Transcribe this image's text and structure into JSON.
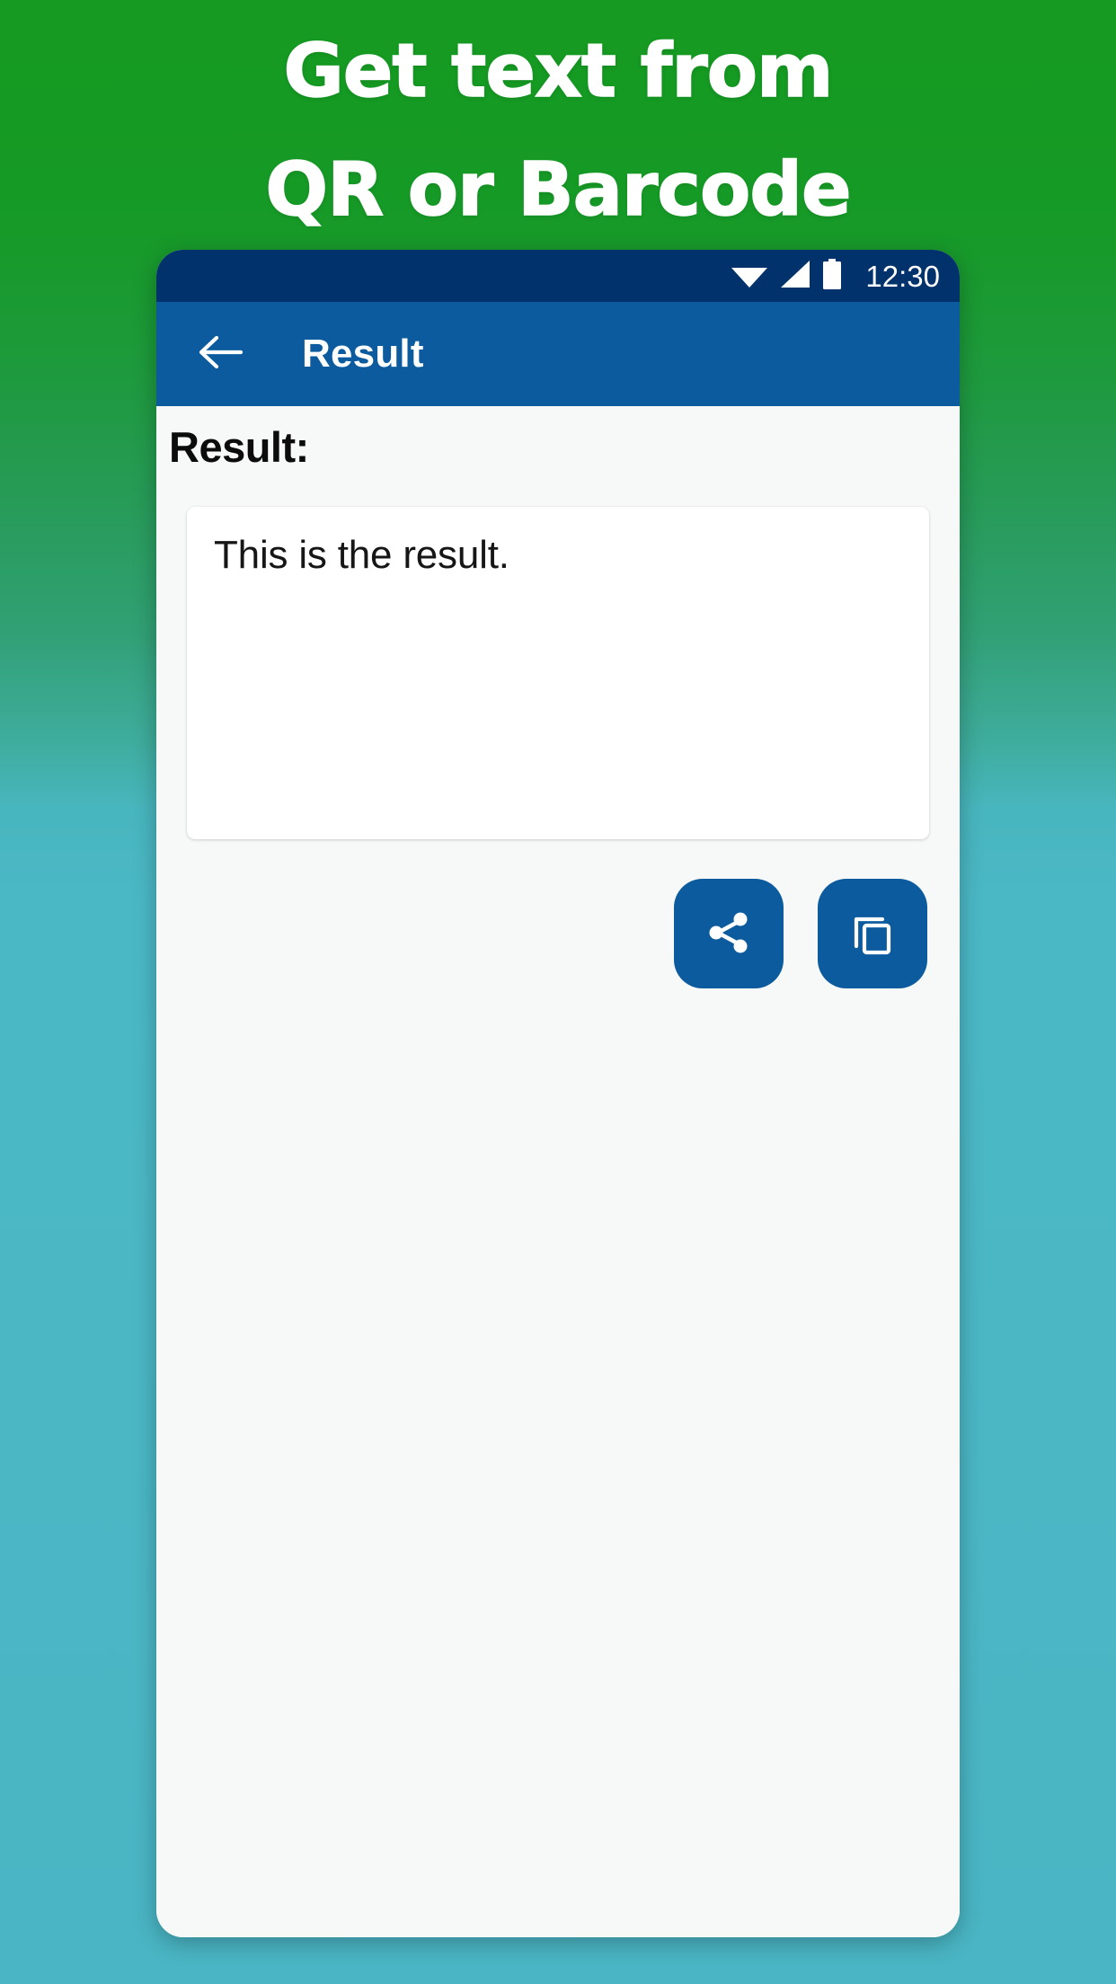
{
  "promo": {
    "headline_line1": "Get text from",
    "headline_line2": "QR or Barcode",
    "bg_gradient_top": "#169A21",
    "bg_gradient_bottom": "#4BB7C5",
    "headline_color": "#FFFFFF"
  },
  "phone": {
    "status_bar": {
      "time": "12:30",
      "background": "#01326B",
      "icons": [
        "wifi-icon",
        "cellular-signal-icon",
        "battery-icon"
      ]
    },
    "app_bar": {
      "title": "Result",
      "background": "#0B5B9E",
      "back_icon": "arrow-left-icon"
    },
    "content": {
      "section_label": "Result:",
      "result_text": "This is the result.",
      "card_background": "#FFFFFF",
      "screen_background": "#F7F8F8"
    },
    "actions": [
      {
        "name": "share",
        "icon": "share-icon",
        "color": "#0B5B9E"
      },
      {
        "name": "copy",
        "icon": "copy-icon",
        "color": "#0B5B9E"
      }
    ]
  }
}
